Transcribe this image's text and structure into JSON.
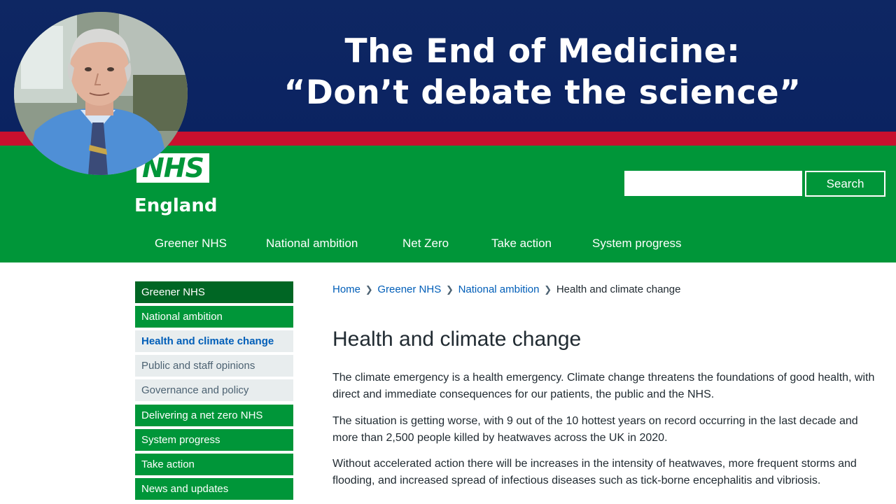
{
  "banner": {
    "title_line1": "The End of Medicine:",
    "title_line2": "“Don’t debate the science”"
  },
  "logo": {
    "mark": "NHS",
    "region": "England"
  },
  "search": {
    "placeholder": "",
    "button_label": "Search"
  },
  "top_nav": {
    "items": [
      "Greener NHS",
      "National ambition",
      "Net Zero",
      "Take action",
      "System progress"
    ]
  },
  "side_nav": {
    "items": [
      "Greener NHS",
      "National ambition",
      "Health and climate change",
      "Public and staff opinions",
      "Governance and policy",
      "Delivering a net zero NHS",
      "System progress",
      "Take action",
      "News and updates"
    ],
    "active_item": "Health and climate change"
  },
  "breadcrumb": {
    "items": [
      "Home",
      "Greener NHS",
      "National ambition"
    ],
    "current": "Health and climate change"
  },
  "main": {
    "title": "Health and climate change",
    "paragraphs": [
      "The climate emergency is a health emergency. Climate change threatens the foundations of good health, with direct and immediate consequences for our patients, the public and the NHS.",
      "The situation is getting worse, with 9 out of the 10 hottest years on record occurring in the last decade and more than 2,500 people killed by heatwaves across the UK in 2020.",
      "Without accelerated action there will be increases in the intensity of heatwaves, more frequent storms and flooding, and increased spread of infectious diseases such as tick-borne encephalitis and vibriosis."
    ]
  },
  "colors": {
    "banner_navy": "#0e2763",
    "stripe_red": "#c8102e",
    "nhs_green": "#009639",
    "nhs_dark_green": "#006624",
    "nhs_blue": "#005eb8",
    "pale_grey": "#e8edee"
  },
  "icons": {
    "breadcrumb_separator": "chevron-right-icon",
    "author_photo": "author-avatar"
  }
}
